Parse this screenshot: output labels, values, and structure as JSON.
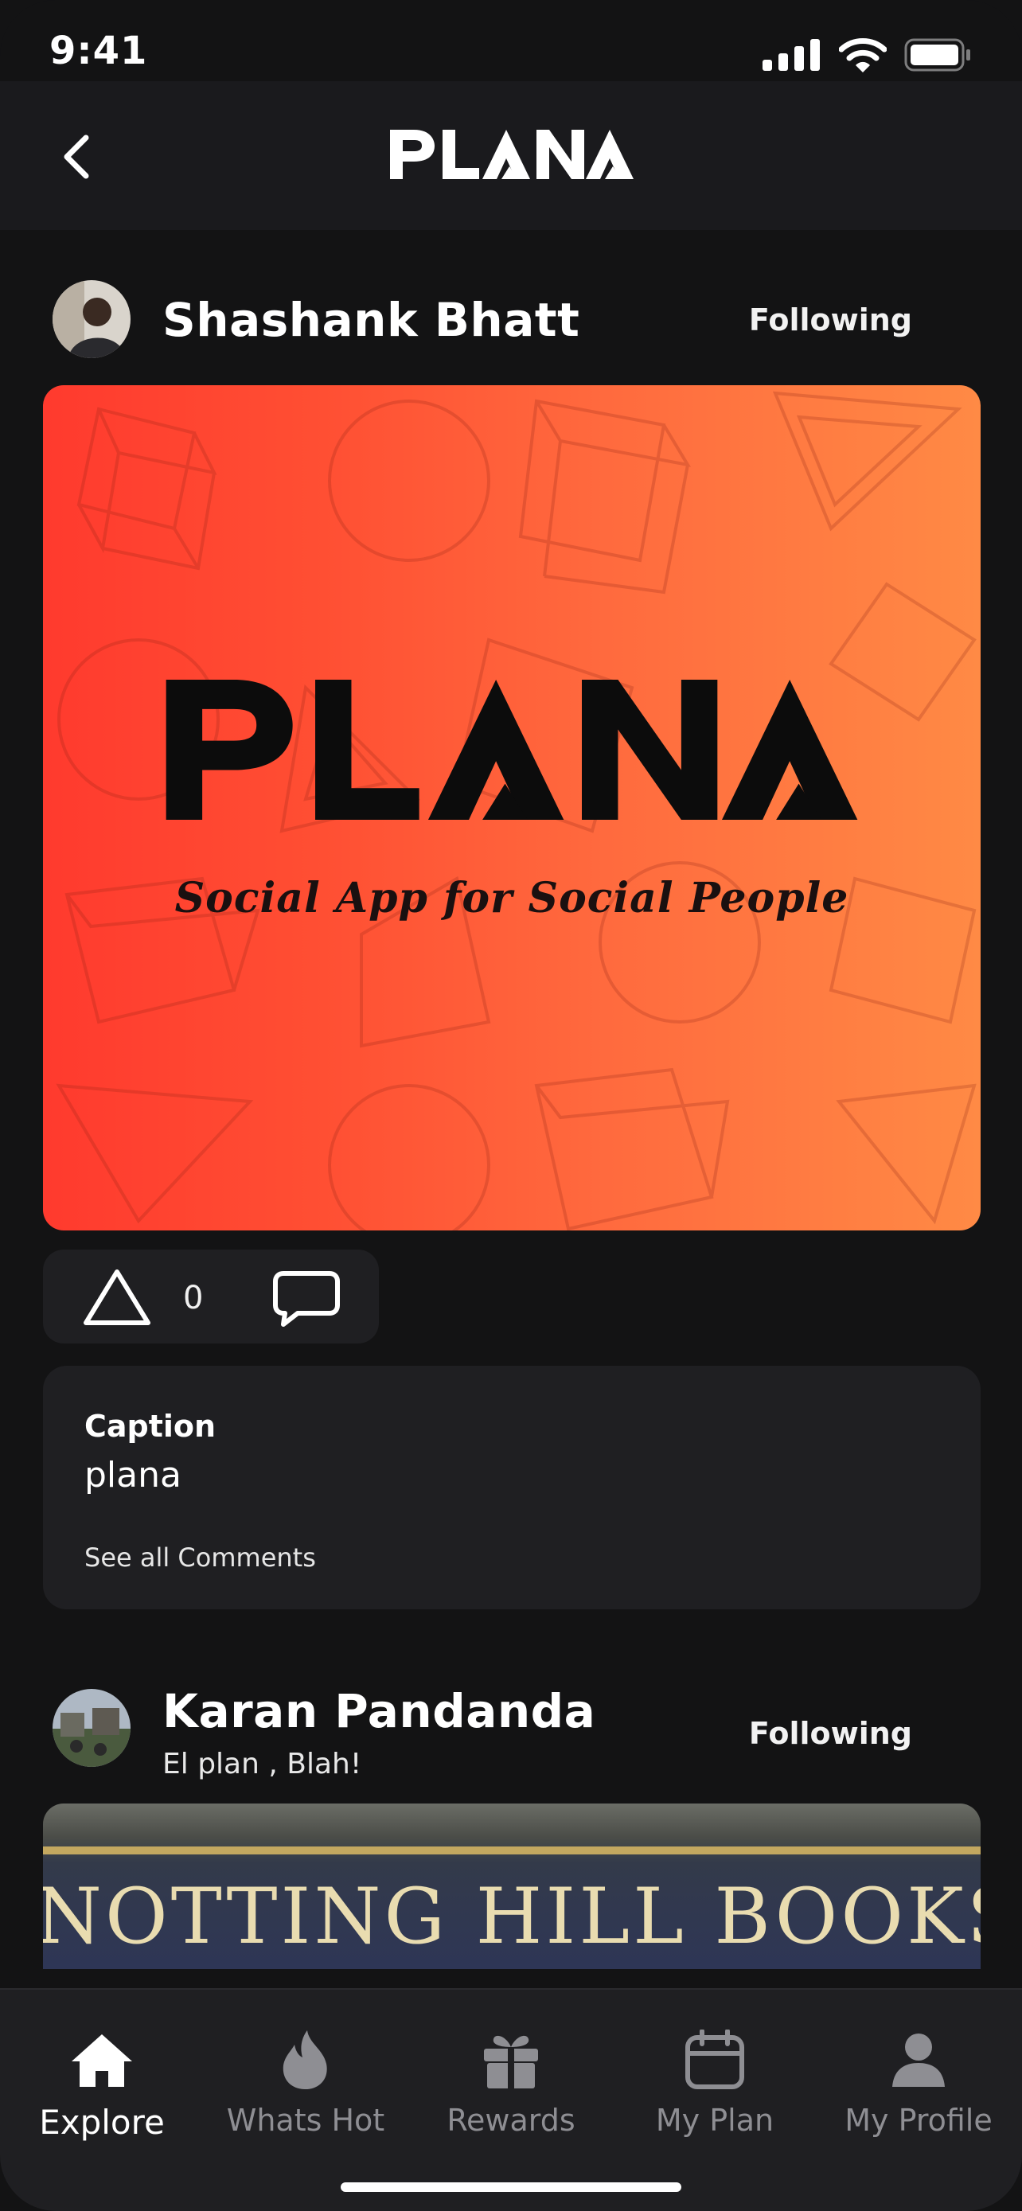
{
  "status_bar": {
    "time": "9:41"
  },
  "header": {
    "app_name": "PLANA"
  },
  "posts": [
    {
      "author": "Shashank Bhatt",
      "follow_state": "Following",
      "image": {
        "title": "PLANA",
        "tagline": "Social App for Social People"
      },
      "likes": "0",
      "caption_label": "Caption",
      "caption": "plana",
      "comments_link": "See all Comments"
    },
    {
      "author": "Karan Pandanda",
      "subtitle": "El plan , Blah!",
      "follow_state": "Following",
      "image": {
        "sign_text": "NOTTING HILL BOOKSHOP"
      }
    }
  ],
  "tabs": [
    {
      "label": "Explore",
      "icon": "home-icon",
      "active": true
    },
    {
      "label": "Whats Hot",
      "icon": "flame-icon"
    },
    {
      "label": "Rewards",
      "icon": "gift-icon"
    },
    {
      "label": "My Plan",
      "icon": "calendar-icon"
    },
    {
      "label": "My Profile",
      "icon": "profile-icon"
    }
  ],
  "colors": {
    "background": "#131314",
    "card": "#1f1f22",
    "gradient_start": "#ff3a2e",
    "gradient_end": "#ff8a45",
    "tab_inactive": "#8e8e93"
  }
}
